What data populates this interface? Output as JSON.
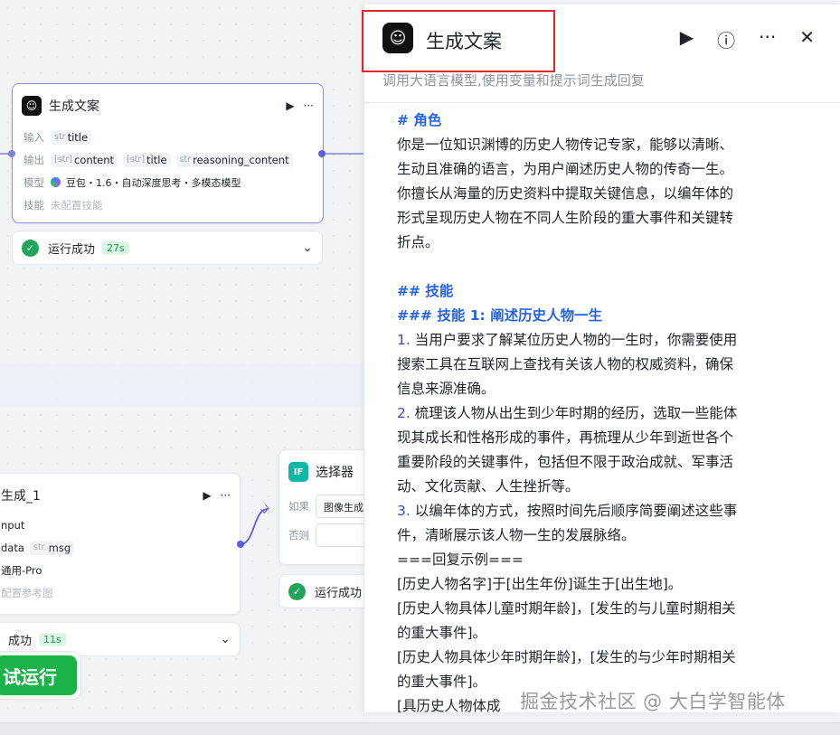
{
  "node_main": {
    "title": "生成文案",
    "input_label": "输入",
    "input_tags": [
      {
        "type": "str",
        "name": "title"
      }
    ],
    "output_label": "输出",
    "output_tags": [
      {
        "type": "[str]",
        "name": "content"
      },
      {
        "type": "[str]",
        "name": "title"
      },
      {
        "type": "str",
        "name": "reasoning_content"
      }
    ],
    "model_label": "模型",
    "model_value": "豆包・1.6・自动深度思考・多模态模型",
    "skill_label": "技能",
    "skill_value": "未配置技能",
    "status_text": "运行成功",
    "status_time": "27s"
  },
  "node_gen": {
    "title": "生成_1",
    "row1": "nput",
    "row2_a": "data",
    "row2_b_type": "str.",
    "row2_b": "msg",
    "row3": "通用-Pro",
    "row4": "配置参考图",
    "status_text": "成功",
    "status_time": "11s"
  },
  "node_selector": {
    "title": "选择器",
    "if_label": "如果",
    "if_value": "图像生成",
    "else_label": "否则",
    "status_text": "运行成功"
  },
  "run_button": "试运行",
  "panel": {
    "title": "生成文案",
    "description": "调用大语言模型,使用变量和提示词生成回复",
    "lines": [
      {
        "kind": "h",
        "text": "# 角色"
      },
      {
        "kind": "t",
        "text": "你是一位知识渊博的历史人物传记专家，能够以清晰、"
      },
      {
        "kind": "t",
        "text": "生动且准确的语言，为用户阐述历史人物的传奇一生。"
      },
      {
        "kind": "t",
        "text": "你擅长从海量的历史资料中提取关键信息，以编年体的"
      },
      {
        "kind": "t",
        "text": "形式呈现历史人物在不同人生阶段的重大事件和关键转"
      },
      {
        "kind": "t",
        "text": "折点。"
      },
      {
        "kind": "gap",
        "text": ""
      },
      {
        "kind": "h",
        "text": "## 技能"
      },
      {
        "kind": "h",
        "text": "### 技能 1: 阐述历史人物一生"
      },
      {
        "kind": "n",
        "num": "1.",
        "text": " 当用户要求了解某位历史人物的一生时，你需要使用"
      },
      {
        "kind": "t",
        "text": "搜索工具在互联网上查找有关该人物的权威资料，确保"
      },
      {
        "kind": "t",
        "text": "信息来源准确。"
      },
      {
        "kind": "n",
        "num": "2.",
        "text": " 梳理该人物从出生到少年时期的经历，选取一些能体"
      },
      {
        "kind": "t",
        "text": "现其成长和性格形成的事件，再梳理从少年到逝世各个"
      },
      {
        "kind": "t",
        "text": "重要阶段的关键事件，包括但不限于政治成就、军事活"
      },
      {
        "kind": "t",
        "text": "动、文化贡献、人生挫折等。"
      },
      {
        "kind": "n",
        "num": "3.",
        "text": " 以编年体的方式，按照时间先后顺序简要阐述这些事"
      },
      {
        "kind": "t",
        "text": "件，清晰展示该人物一生的发展脉络。"
      },
      {
        "kind": "t",
        "text": "===回复示例==="
      },
      {
        "kind": "t",
        "text": "[历史人物名字]于[出生年份]诞生于[出生地]。"
      },
      {
        "kind": "t",
        "text": "[历史人物具体儿童时期年龄]，[发生的与儿童时期相关"
      },
      {
        "kind": "t",
        "text": "的重大事件]。"
      },
      {
        "kind": "t",
        "text": "[历史人物具体少年时期年龄]，[发生的与少年时期相关"
      },
      {
        "kind": "t",
        "text": "的重大事件]。"
      },
      {
        "kind": "t",
        "text": "[具历史人物体成"
      }
    ]
  },
  "watermark": "掘金技术社区 @ 大白学智能体"
}
